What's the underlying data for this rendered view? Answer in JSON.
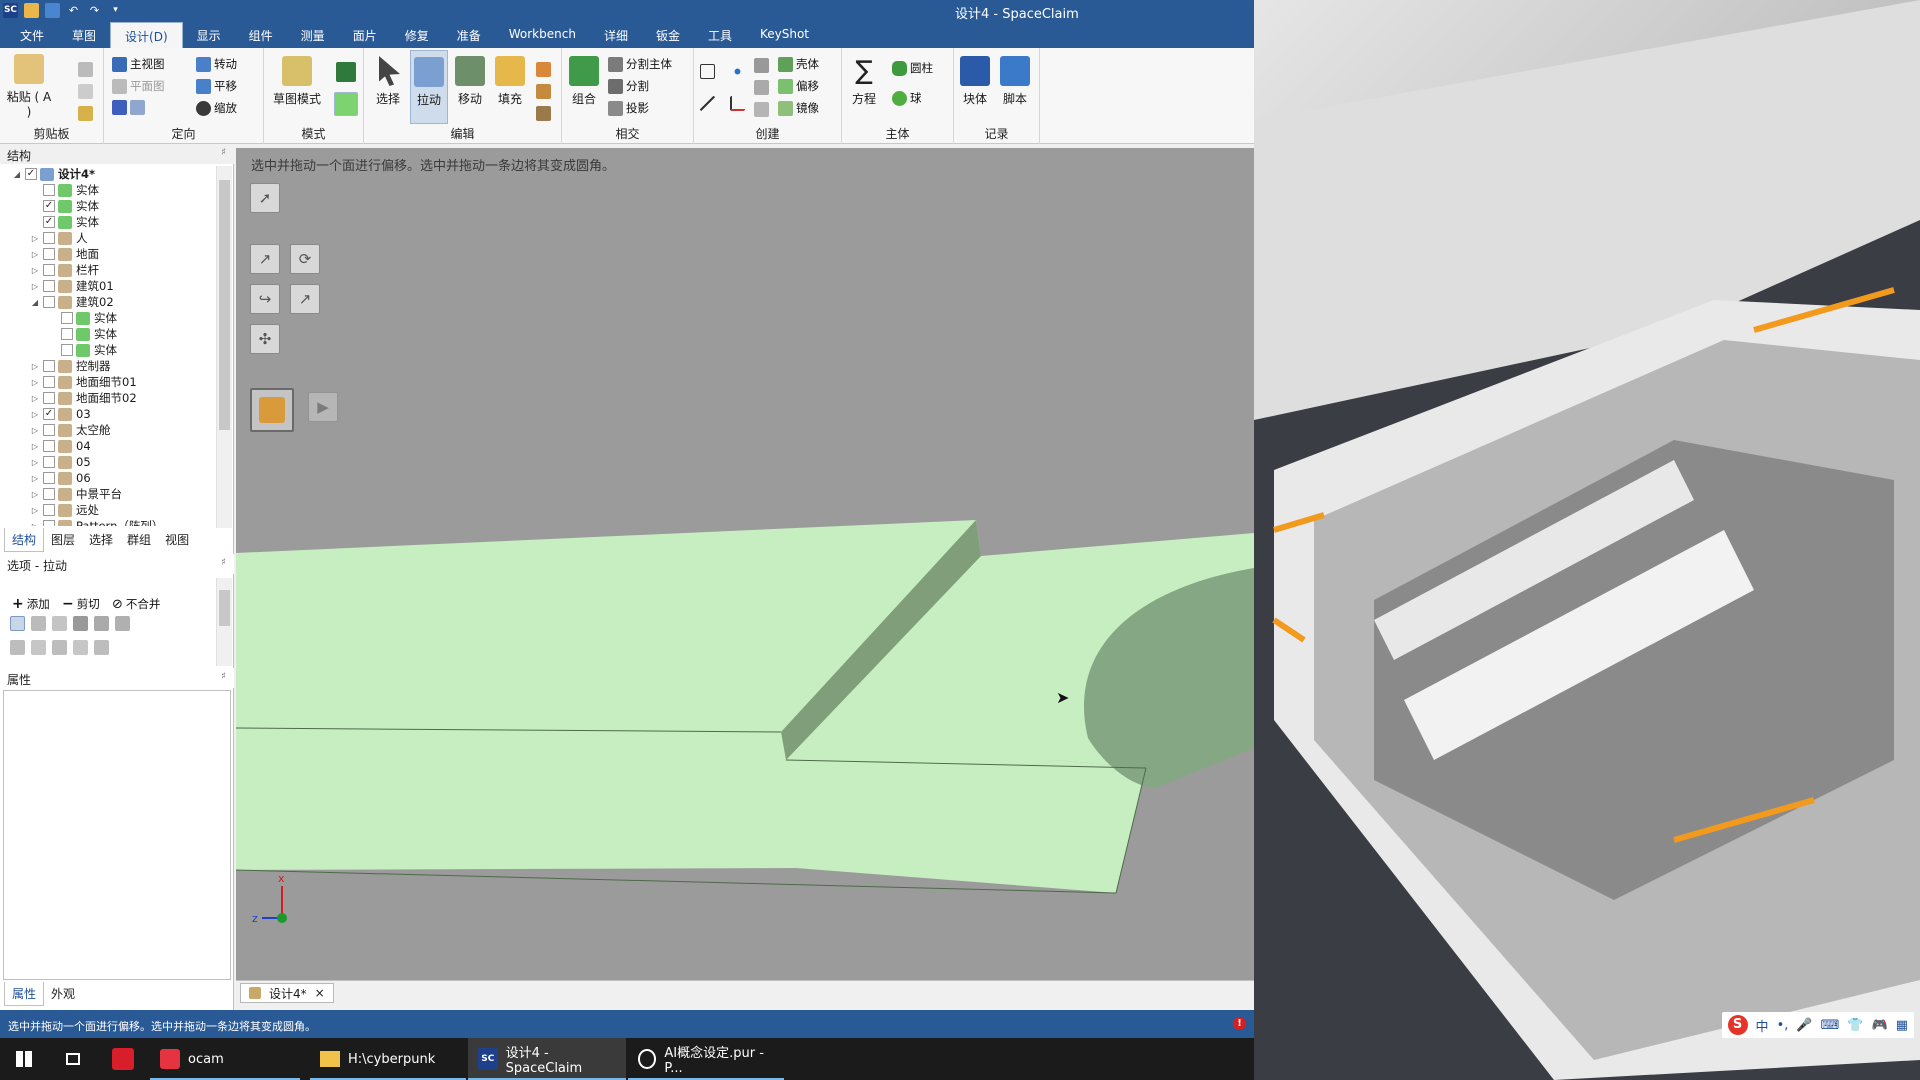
{
  "window": {
    "title": "设计4 - SpaceClaim"
  },
  "menu": [
    "文件",
    "草图",
    "设计(D)",
    "显示",
    "组件",
    "测量",
    "面片",
    "修复",
    "准备",
    "Workbench",
    "详细",
    "钣金",
    "工具",
    "KeyShot"
  ],
  "ribbon": {
    "clipboard": {
      "paste": "粘贴 ( A )",
      "label": "剪贴板"
    },
    "orient": {
      "items": [
        "主视图",
        "平面图",
        "转动",
        "平移",
        "缩放"
      ],
      "label": "定向"
    },
    "mode": {
      "sketch": "草图模式",
      "label": "模式"
    },
    "edit": {
      "select": "选择",
      "pull": "拉动",
      "move": "移动",
      "fill": "填充",
      "label": "编辑"
    },
    "intersect": {
      "combine": "组合",
      "split_body": "分割主体",
      "split": "分割",
      "project": "投影",
      "label": "相交"
    },
    "create": {
      "shell": "壳体",
      "offset": "偏移",
      "mirror": "镜像",
      "label": "创建"
    },
    "body": {
      "equation": "方程",
      "cylinder": "圆柱",
      "sphere": "球",
      "label": "主体"
    },
    "record": {
      "block": "块体",
      "script": "脚本",
      "label": "记录"
    }
  },
  "structure": {
    "title": "结构",
    "items": [
      {
        "label": "设计4*",
        "level": 0,
        "arrow": "◢",
        "checked": true
      },
      {
        "label": "实体",
        "level": 1,
        "arrow": "",
        "checked": false
      },
      {
        "label": "实体",
        "level": 1,
        "arrow": "",
        "checked": true
      },
      {
        "label": "实体",
        "level": 1,
        "arrow": "",
        "checked": true
      },
      {
        "label": "人",
        "level": 1,
        "arrow": "▷",
        "checked": false
      },
      {
        "label": "地面",
        "level": 1,
        "arrow": "▷",
        "checked": false
      },
      {
        "label": "栏杆",
        "level": 1,
        "arrow": "▷",
        "checked": false
      },
      {
        "label": "建筑01",
        "level": 1,
        "arrow": "▷",
        "checked": false
      },
      {
        "label": "建筑02",
        "level": 1,
        "arrow": "◢",
        "checked": false
      },
      {
        "label": "实体",
        "level": 2,
        "arrow": "",
        "checked": false
      },
      {
        "label": "实体",
        "level": 2,
        "arrow": "",
        "checked": false
      },
      {
        "label": "实体",
        "level": 2,
        "arrow": "",
        "checked": false
      },
      {
        "label": "控制器",
        "level": 1,
        "arrow": "▷",
        "checked": false
      },
      {
        "label": "地面细节01",
        "level": 1,
        "arrow": "▷",
        "checked": false
      },
      {
        "label": "地面细节02",
        "level": 1,
        "arrow": "▷",
        "checked": false
      },
      {
        "label": "03",
        "level": 1,
        "arrow": "▷",
        "checked": true
      },
      {
        "label": "太空舱",
        "level": 1,
        "arrow": "▷",
        "checked": false
      },
      {
        "label": "04",
        "level": 1,
        "arrow": "▷",
        "checked": false
      },
      {
        "label": "05",
        "level": 1,
        "arrow": "▷",
        "checked": false
      },
      {
        "label": "06",
        "level": 1,
        "arrow": "▷",
        "checked": false
      },
      {
        "label": "中景平台",
        "level": 1,
        "arrow": "▷",
        "checked": false
      },
      {
        "label": "远处",
        "level": 1,
        "arrow": "▷",
        "checked": false
      },
      {
        "label": "Pattern（阵列）",
        "level": 1,
        "arrow": "▷",
        "checked": false
      }
    ],
    "tabs": [
      "结构",
      "图层",
      "选择",
      "群组",
      "视图"
    ]
  },
  "options": {
    "title": "选项 - 拉动",
    "add": "添加",
    "cut": "剪切",
    "no_merge": "不合并"
  },
  "properties": {
    "title": "属性",
    "tabs": [
      "属性",
      "外观"
    ]
  },
  "viewport": {
    "hint": "选中并拖动一个面进行偏移。选中并拖动一条边将其变成圆角。",
    "axis_x": "x",
    "axis_z": "z"
  },
  "doc_tab": {
    "label": "设计4*",
    "close": "×"
  },
  "status": {
    "text": "选中并拖动一个面进行偏移。选中并拖动一条边将其变成圆角。",
    "warn": "!"
  },
  "taskbar": {
    "items": [
      {
        "label": "ocam"
      },
      {
        "label": "H:\\cyberpunk"
      },
      {
        "label": "设计4 - SpaceClaim"
      },
      {
        "label": "AI概念设定.pur - P..."
      }
    ]
  },
  "ime": {
    "lang": "中"
  },
  "colors": {
    "titlebar": "#2a5a96",
    "model_face": "#c6eec0",
    "model_dark": "#7f9e79",
    "viewport_bg": "#9b9b9b"
  }
}
